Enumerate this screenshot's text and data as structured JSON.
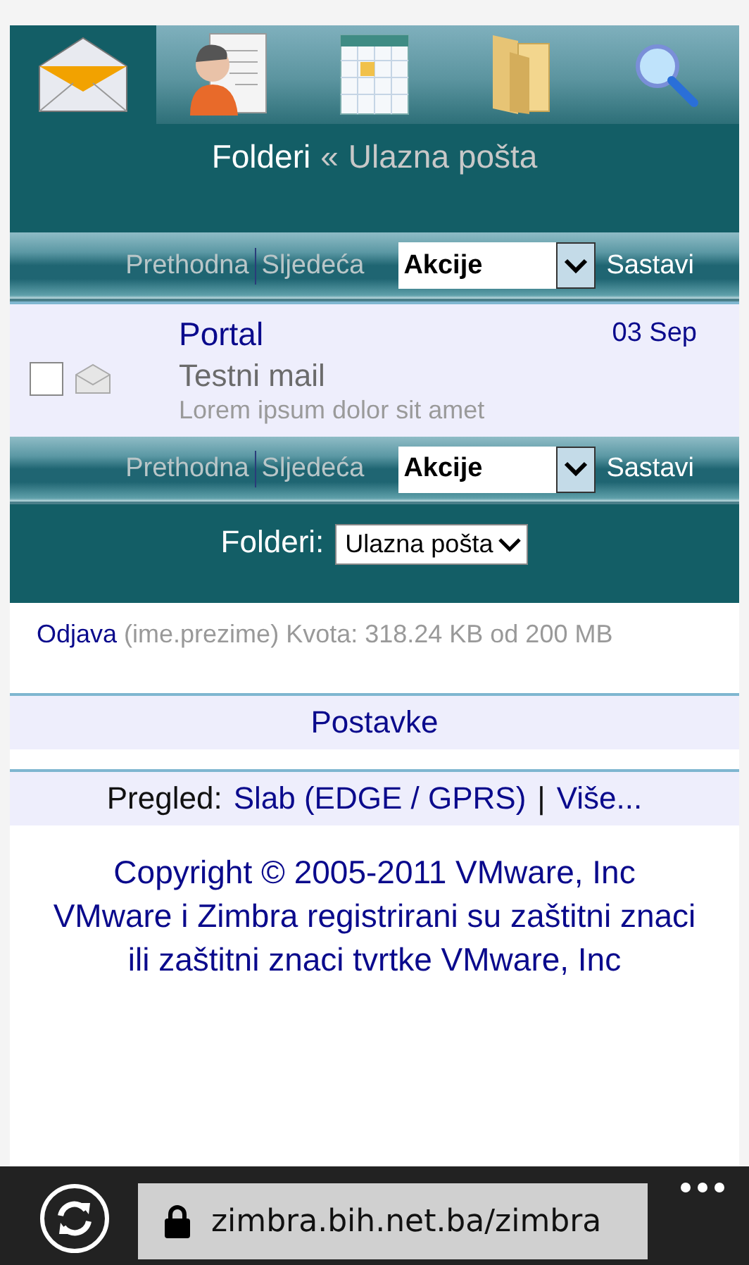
{
  "tabs": [
    {
      "kind": "mail",
      "selected": true
    },
    {
      "kind": "contacts",
      "selected": false
    },
    {
      "kind": "calendar",
      "selected": false
    },
    {
      "kind": "folders",
      "selected": false
    },
    {
      "kind": "search",
      "selected": false
    }
  ],
  "breadcrumb": {
    "parent": "Folderi",
    "separator": "«",
    "current": "Ulazna pošta"
  },
  "toolbars": [
    {
      "prev": {
        "label": "Prethodna",
        "disabled": true
      },
      "next": {
        "label": "Sljedeća",
        "disabled": true
      },
      "actions": {
        "value": "Akcije"
      },
      "compose": "Sastavi"
    },
    {
      "prev": {
        "label": "Prethodna",
        "disabled": true
      },
      "next": {
        "label": "Sljedeća",
        "disabled": true
      },
      "actions": {
        "value": "Akcije"
      },
      "compose": "Sastavi"
    }
  ],
  "messages": [
    {
      "sender": "Portal",
      "subject": "Testni mail",
      "preview": "Lorem ipsum dolor sit amet",
      "date": "03 Sep",
      "checked": false,
      "unread": false
    }
  ],
  "folder_picker": {
    "label": "Folderi:",
    "value": "Ulazna pošta"
  },
  "account": {
    "logout": "Odjava",
    "user": "(ime.prezime)",
    "quota": "Kvota: 318.24 KB od 200 MB"
  },
  "settings_link": "Postavke",
  "view": {
    "label": "Pregled:",
    "mode": "Slab (EDGE / GPRS)",
    "separator": "|",
    "more": "Više..."
  },
  "copyright": [
    "Copyright © 2005-2011 VMware, Inc",
    "VMware i Zimbra registrirani su zaštitni znaci",
    "ili zaštitni znaci tvrtke VMware, Inc"
  ],
  "browser": {
    "url": "zimbra.bih.net.ba/zimbra"
  }
}
